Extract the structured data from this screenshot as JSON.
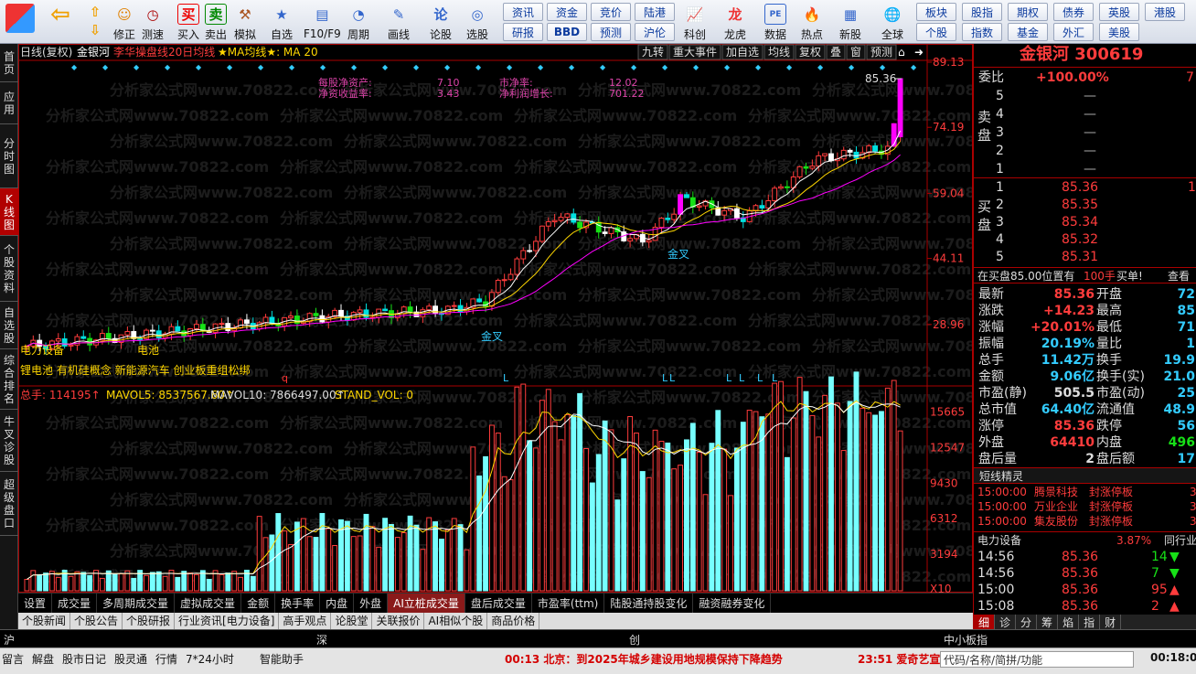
{
  "toolbar": {
    "buttons": [
      "",
      "",
      "修正",
      "测速",
      "买入",
      "卖出",
      "模拟",
      "自选",
      "F10/F9",
      "周期",
      "画线",
      "论股",
      "选股",
      "",
      "",
      "",
      "科创",
      "龙虎",
      "数据",
      "热点",
      "新股",
      "全球"
    ],
    "grid": [
      [
        "资讯",
        "资金",
        "竞价",
        "陆港"
      ],
      [
        "研报",
        "BBD",
        "预测",
        "沪伦"
      ]
    ],
    "grid2": [
      [
        "板块",
        "股指",
        "期权",
        "债券",
        "英股",
        "港股"
      ],
      [
        "个股",
        "指数",
        "基金",
        "外汇",
        "美股",
        ""
      ]
    ]
  },
  "leftnav": [
    {
      "label": "首页"
    },
    {
      "label": "应用"
    },
    {
      "label": "分时图"
    },
    {
      "label": "K线图"
    },
    {
      "label": "个股资料"
    },
    {
      "label": "自选股"
    },
    {
      "label": "综合排名"
    },
    {
      "label": "牛叉诊股"
    },
    {
      "label": "超级盘口"
    }
  ],
  "chart": {
    "header": "日线(复权)",
    "name": "金银河",
    "formula": "李华操盘线20日均线",
    "ma_label": "★MA均线★: MA 20",
    "buttons": [
      "九转",
      "重大事件",
      "加自选",
      "均线",
      "复权",
      "叠",
      "窗",
      "预测"
    ],
    "price_ticks": [
      "89.13",
      "74.19",
      "59.04",
      "44.11",
      "28.96"
    ],
    "max_label": "85.36",
    "fin": {
      "l1": "每股净资产:",
      "v1": "7.10",
      "l2": "市净率:",
      "v2": "12.02",
      "l3": "净资收益率:",
      "v3": "3.43",
      "l4": "净利润增长:",
      "v4": "701.22"
    },
    "concepts1": "电力设备",
    "concepts1b": "电池",
    "concepts2": "锂电池  有机硅概念  新能源汽车  创业板重组松绑",
    "gold_cross": "金叉",
    "vol_header": {
      "v": "总手: 114195↑",
      "m5": "MAVOL5: 8537567.60↑",
      "m10": "MAVOL10: 7866497.00↑",
      "sv": "STAND_VOL: 0"
    },
    "vol_ticks": [
      "15665",
      "12547",
      "9430",
      "6312",
      "3194",
      "X10"
    ],
    "watermark": "分析家公式网www.70822.com",
    "colors": {
      "up": "#ff3c3c",
      "down": "#00e0e0",
      "ma": "#ffffff"
    }
  },
  "chart_data": {
    "type": "candlestick",
    "last_close": 85.36,
    "max": 85.36,
    "ylim": [
      22,
      89.13
    ]
  },
  "rp": {
    "title": "金银河  300619",
    "weibi_l": "委比",
    "weibi_v": "+100.00%",
    "weibi_r": "7",
    "sell_label": "卖盘",
    "buy_label": "买盘",
    "sells": [
      [
        "5",
        "",
        ""
      ],
      [
        "4",
        "",
        ""
      ],
      [
        "3",
        "",
        ""
      ],
      [
        "2",
        "",
        ""
      ],
      [
        "1",
        "",
        ""
      ]
    ],
    "buys": [
      [
        "1",
        "85.36",
        "1"
      ],
      [
        "2",
        "85.35",
        ""
      ],
      [
        "3",
        "85.34",
        ""
      ],
      [
        "4",
        "85.32",
        ""
      ],
      [
        "5",
        "85.31",
        ""
      ]
    ],
    "zaimai": "在买盘85.00位置有",
    "zaimai_v": "100手",
    "zaimai_b": "买单!",
    "zaimai_c": "查看",
    "stats": [
      [
        "最新",
        "85.36",
        "开盘",
        "72"
      ],
      [
        "涨跌",
        "+14.23",
        "最高",
        "85"
      ],
      [
        "涨幅",
        "+20.01%",
        "最低",
        "71"
      ],
      [
        "振幅",
        "20.19%",
        "量比",
        "1"
      ],
      [
        "总手",
        "11.42万",
        "换手",
        "19.9"
      ],
      [
        "金额",
        "9.06亿",
        "换手(实)",
        "21.0"
      ],
      [
        "市盈(静)",
        "505.5",
        "市盈(动)",
        "25"
      ],
      [
        "总市值",
        "64.40亿",
        "流通值",
        "48.9"
      ],
      [
        "涨停",
        "85.36",
        "跌停",
        "56"
      ],
      [
        "外盘",
        "64410",
        "内盘",
        "496"
      ],
      [
        "盘后量",
        "2",
        "盘后额",
        "17"
      ]
    ],
    "jingling": "短线精灵",
    "jl": [
      [
        "15:00:00",
        "腾景科技",
        "封涨停板",
        "3"
      ],
      [
        "15:00:00",
        "万业企业",
        "封涨停板",
        "3"
      ],
      [
        "15:00:00",
        "集友股份",
        "封涨停板",
        "3"
      ]
    ],
    "sector": "电力设备",
    "sector_v": "3.87%",
    "sector_r": "同行业比",
    "ticks": [
      [
        "14:56",
        "85.36",
        "14"
      ],
      [
        "14:56",
        "85.36",
        "7"
      ],
      [
        "15:00",
        "85.36",
        "95"
      ],
      [
        "15:08",
        "85.36",
        "2"
      ]
    ],
    "bottom_tabs": [
      "细",
      "诊",
      "分",
      "筹",
      "焰",
      "指",
      "财"
    ]
  },
  "tabs1": [
    "设置",
    "成交量",
    "多周期成交量",
    "虚拟成交量",
    "金额",
    "换手率",
    "内盘",
    "外盘",
    "AI立桩成交量",
    "盘后成交量",
    "市盈率(ttm)",
    "陆股通持股变化",
    "融资融券变化"
  ],
  "tabs2": [
    "个股新闻",
    "个股公告",
    "个股研报",
    "行业资讯[电力设备]",
    "高手观点",
    "论股堂",
    "关联报价",
    "AI相似个股",
    "商品价格"
  ],
  "indexbar": {
    "a": "沪",
    "b": "深",
    "c": "创",
    "d": "中小板指"
  },
  "status": {
    "items": [
      "留言",
      "解盘",
      "股市日记",
      "股灵通",
      "行情",
      "7*24小时",
      "智能助手"
    ],
    "news": "00:13  北京：到2025年城乡建设用地规模保持下降趋势",
    "news2": "23:51  爱奇艺宣",
    "search": "代码/名称/简拼/功能",
    "time": "00:18:0"
  }
}
